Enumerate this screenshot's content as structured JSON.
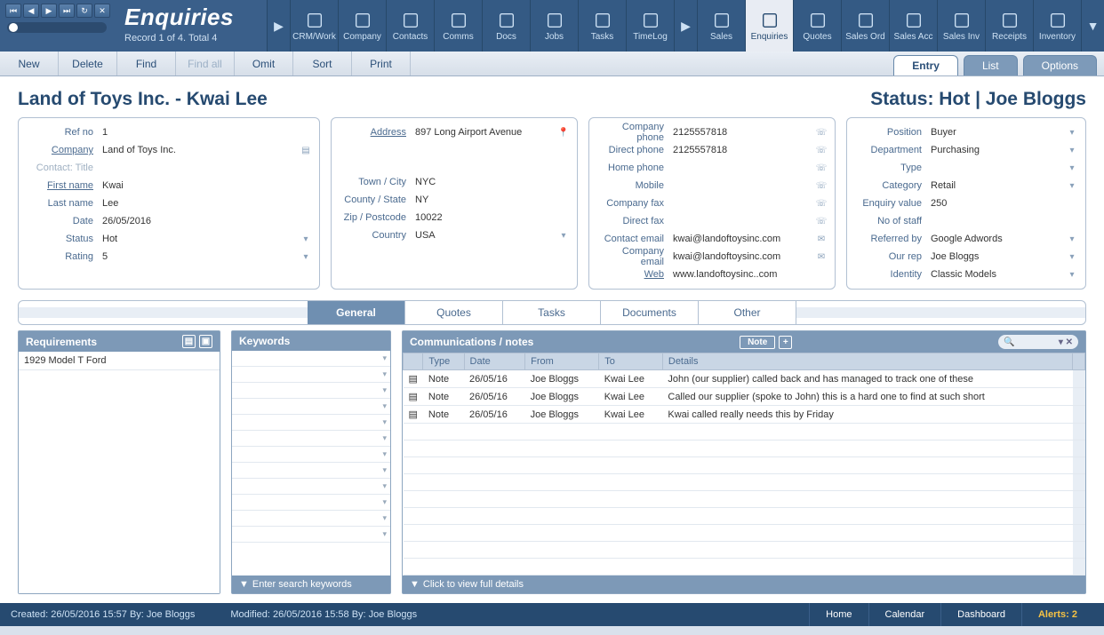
{
  "header": {
    "title": "Enquiries",
    "record_status": "Record 1 of 4. Total 4",
    "modules": [
      "CRM/Work",
      "Company",
      "Contacts",
      "Comms",
      "Docs",
      "Jobs",
      "Tasks",
      "TimeLog",
      "Sales",
      "Enquiries",
      "Quotes",
      "Sales Ord",
      "Sales Acc",
      "Sales Inv",
      "Receipts",
      "Inventory"
    ],
    "active_module": "Enquiries"
  },
  "actions": [
    "New",
    "Delete",
    "Find",
    "Find all",
    "Omit",
    "Sort",
    "Print"
  ],
  "view_tabs": [
    "Entry",
    "List",
    "Options"
  ],
  "active_view_tab": "Entry",
  "record": {
    "heading": "Land of Toys Inc. - Kwai Lee",
    "status_line": "Status: Hot | Joe Bloggs"
  },
  "fields": {
    "ref_no": {
      "label": "Ref no",
      "value": "1"
    },
    "company": {
      "label": "Company",
      "value": "Land of Toys Inc."
    },
    "contact_title": {
      "label": "Contact: Title",
      "value": ""
    },
    "first_name": {
      "label": "First name",
      "value": "Kwai"
    },
    "last_name": {
      "label": "Last name",
      "value": "Lee"
    },
    "date": {
      "label": "Date",
      "value": "26/05/2016"
    },
    "status": {
      "label": "Status",
      "value": "Hot"
    },
    "rating": {
      "label": "Rating",
      "value": "5"
    },
    "address": {
      "label": "Address",
      "value": "897 Long Airport Avenue"
    },
    "town": {
      "label": "Town / City",
      "value": "NYC"
    },
    "county": {
      "label": "County / State",
      "value": "NY"
    },
    "zip": {
      "label": "Zip / Postcode",
      "value": "10022"
    },
    "country": {
      "label": "Country",
      "value": "USA"
    },
    "company_phone": {
      "label": "Company phone",
      "value": "2125557818"
    },
    "direct_phone": {
      "label": "Direct phone",
      "value": "2125557818"
    },
    "home_phone": {
      "label": "Home phone",
      "value": ""
    },
    "mobile": {
      "label": "Mobile",
      "value": ""
    },
    "company_fax": {
      "label": "Company fax",
      "value": ""
    },
    "direct_fax": {
      "label": "Direct fax",
      "value": ""
    },
    "contact_email": {
      "label": "Contact email",
      "value": "kwai@landoftoysinc.com"
    },
    "company_email": {
      "label": "Company email",
      "value": "kwai@landoftoysinc.com"
    },
    "web": {
      "label": "Web",
      "value": "www.landoftoysinc..com"
    },
    "position": {
      "label": "Position",
      "value": "Buyer"
    },
    "department": {
      "label": "Department",
      "value": "Purchasing"
    },
    "type": {
      "label": "Type",
      "value": ""
    },
    "category": {
      "label": "Category",
      "value": "Retail"
    },
    "enquiry_value": {
      "label": "Enquiry value",
      "value": "250"
    },
    "no_staff": {
      "label": "No of staff",
      "value": ""
    },
    "referred_by": {
      "label": "Referred by",
      "value": "Google Adwords"
    },
    "our_rep": {
      "label": "Our rep",
      "value": "Joe Bloggs"
    },
    "identity": {
      "label": "Identity",
      "value": "Classic Models"
    }
  },
  "subtabs": [
    "General",
    "Quotes",
    "Tasks",
    "Documents",
    "Other"
  ],
  "active_subtab": "General",
  "requirements": {
    "title": "Requirements",
    "items": [
      "1929 Model T Ford"
    ]
  },
  "keywords": {
    "title": "Keywords",
    "footer": "Enter search keywords"
  },
  "comms": {
    "title": "Communications / notes",
    "note_btn": "Note",
    "columns": [
      "Type",
      "Date",
      "From",
      "To",
      "Details"
    ],
    "rows": [
      {
        "type": "Note",
        "date": "26/05/16",
        "from": "Joe Bloggs",
        "to": "Kwai Lee",
        "details": "John (our supplier) called back and has managed to track one of these"
      },
      {
        "type": "Note",
        "date": "26/05/16",
        "from": "Joe Bloggs",
        "to": "Kwai Lee",
        "details": "Called our supplier (spoke to John) this is a hard one to find at such short"
      },
      {
        "type": "Note",
        "date": "26/05/16",
        "from": "Joe Bloggs",
        "to": "Kwai Lee",
        "details": "Kwai called really needs this by Friday"
      }
    ],
    "footer": "Click to view full details"
  },
  "footer": {
    "created": "Created: 26/05/2016  15:57    By: Joe Bloggs",
    "modified": "Modified: 26/05/2016  15:58    By: Joe Bloggs",
    "buttons": [
      "Home",
      "Calendar",
      "Dashboard"
    ],
    "alerts": "Alerts: 2"
  }
}
